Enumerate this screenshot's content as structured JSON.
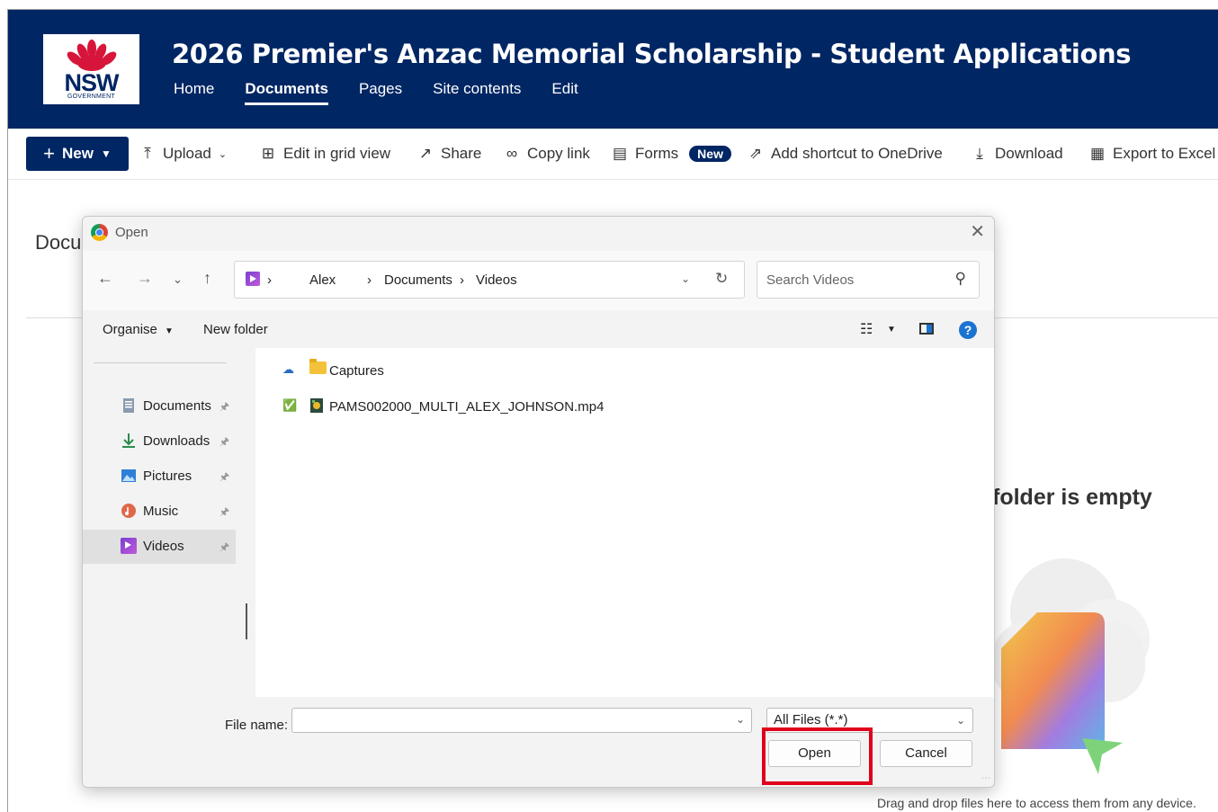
{
  "header": {
    "logo_text": "NSW",
    "logo_subtext": "GOVERNMENT",
    "site_title": "2026 Premier's Anzac Memorial Scholarship - Student Applications",
    "nav": [
      {
        "label": "Home",
        "active": false
      },
      {
        "label": "Documents",
        "active": true
      },
      {
        "label": "Pages",
        "active": false
      },
      {
        "label": "Site contents",
        "active": false
      },
      {
        "label": "Edit",
        "active": false
      }
    ],
    "brand_color": "#002664"
  },
  "commandbar": {
    "new_label": "New",
    "upload_label": "Upload",
    "edit_grid_label": "Edit in grid view",
    "share_label": "Share",
    "copy_link_label": "Copy link",
    "forms_label": "Forms",
    "forms_badge": "New",
    "shortcut_label": "Add shortcut to OneDrive",
    "download_label": "Download",
    "export_label": "Export to Excel"
  },
  "background": {
    "docs_heading": "Docu",
    "empty_text": "folder is empty",
    "drag_text": "Drag and drop files here to access them from any device."
  },
  "dialog": {
    "title": "Open",
    "breadcrumb": [
      "Alex",
      "Documents",
      "Videos"
    ],
    "search_placeholder": "Search Videos",
    "toolbar": {
      "organise": "Organise",
      "new_folder": "New folder"
    },
    "sidebar": [
      {
        "label": "Documents",
        "icon": "documents-icon",
        "selected": false
      },
      {
        "label": "Downloads",
        "icon": "downloads-icon",
        "selected": false
      },
      {
        "label": "Pictures",
        "icon": "pictures-icon",
        "selected": false
      },
      {
        "label": "Music",
        "icon": "music-icon",
        "selected": false
      },
      {
        "label": "Videos",
        "icon": "videos-icon",
        "selected": true
      }
    ],
    "files": [
      {
        "name": "Captures",
        "type": "folder",
        "status": "cloud-icon"
      },
      {
        "name": "PAMS002000_MULTI_ALEX_JOHNSON.mp4",
        "type": "video",
        "status": "synced-check-icon"
      }
    ],
    "file_name_label": "File name:",
    "file_name_value": "",
    "file_type_value": "All Files (*.*)",
    "open_label": "Open",
    "cancel_label": "Cancel",
    "highlight_color": "#e0001b"
  }
}
